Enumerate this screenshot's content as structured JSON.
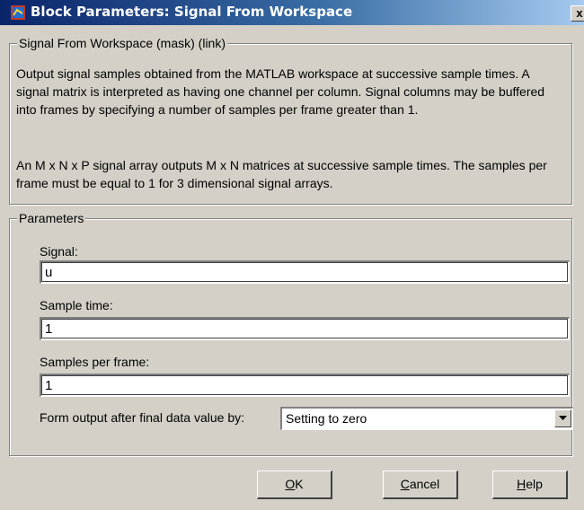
{
  "window": {
    "title": "Block Parameters: Signal From Workspace",
    "close_glyph": "x"
  },
  "description_group": {
    "label": "Signal From Workspace (mask) (link)",
    "paragraph1": "Output signal samples obtained from the MATLAB workspace at successive sample times.  A signal matrix is interpreted as having one channel per column.  Signal columns may be buffered into frames by specifying a number of samples per frame greater than 1.",
    "paragraph2": "An M x N x P signal array outputs M x N matrices at successive sample times.  The samples per frame must be equal to 1 for 3 dimensional signal arrays."
  },
  "parameters": {
    "label": "Parameters",
    "signal": {
      "label": "Signal:",
      "value": "u"
    },
    "sample_time": {
      "label": "Sample time:",
      "value": "1"
    },
    "samples_per_frame": {
      "label": "Samples per frame:",
      "value": "1"
    },
    "form_output": {
      "label": "Form output after final data value by:",
      "selected": "Setting to zero"
    }
  },
  "buttons": {
    "ok_mnemonic": "O",
    "ok_rest": "K",
    "cancel_mnemonic": "C",
    "cancel_rest": "ancel",
    "help_mnemonic": "H",
    "help_rest": "elp"
  },
  "icons": {
    "app": "simulink-block-icon",
    "close": "close-icon",
    "dropdown": "chevron-down-icon"
  }
}
